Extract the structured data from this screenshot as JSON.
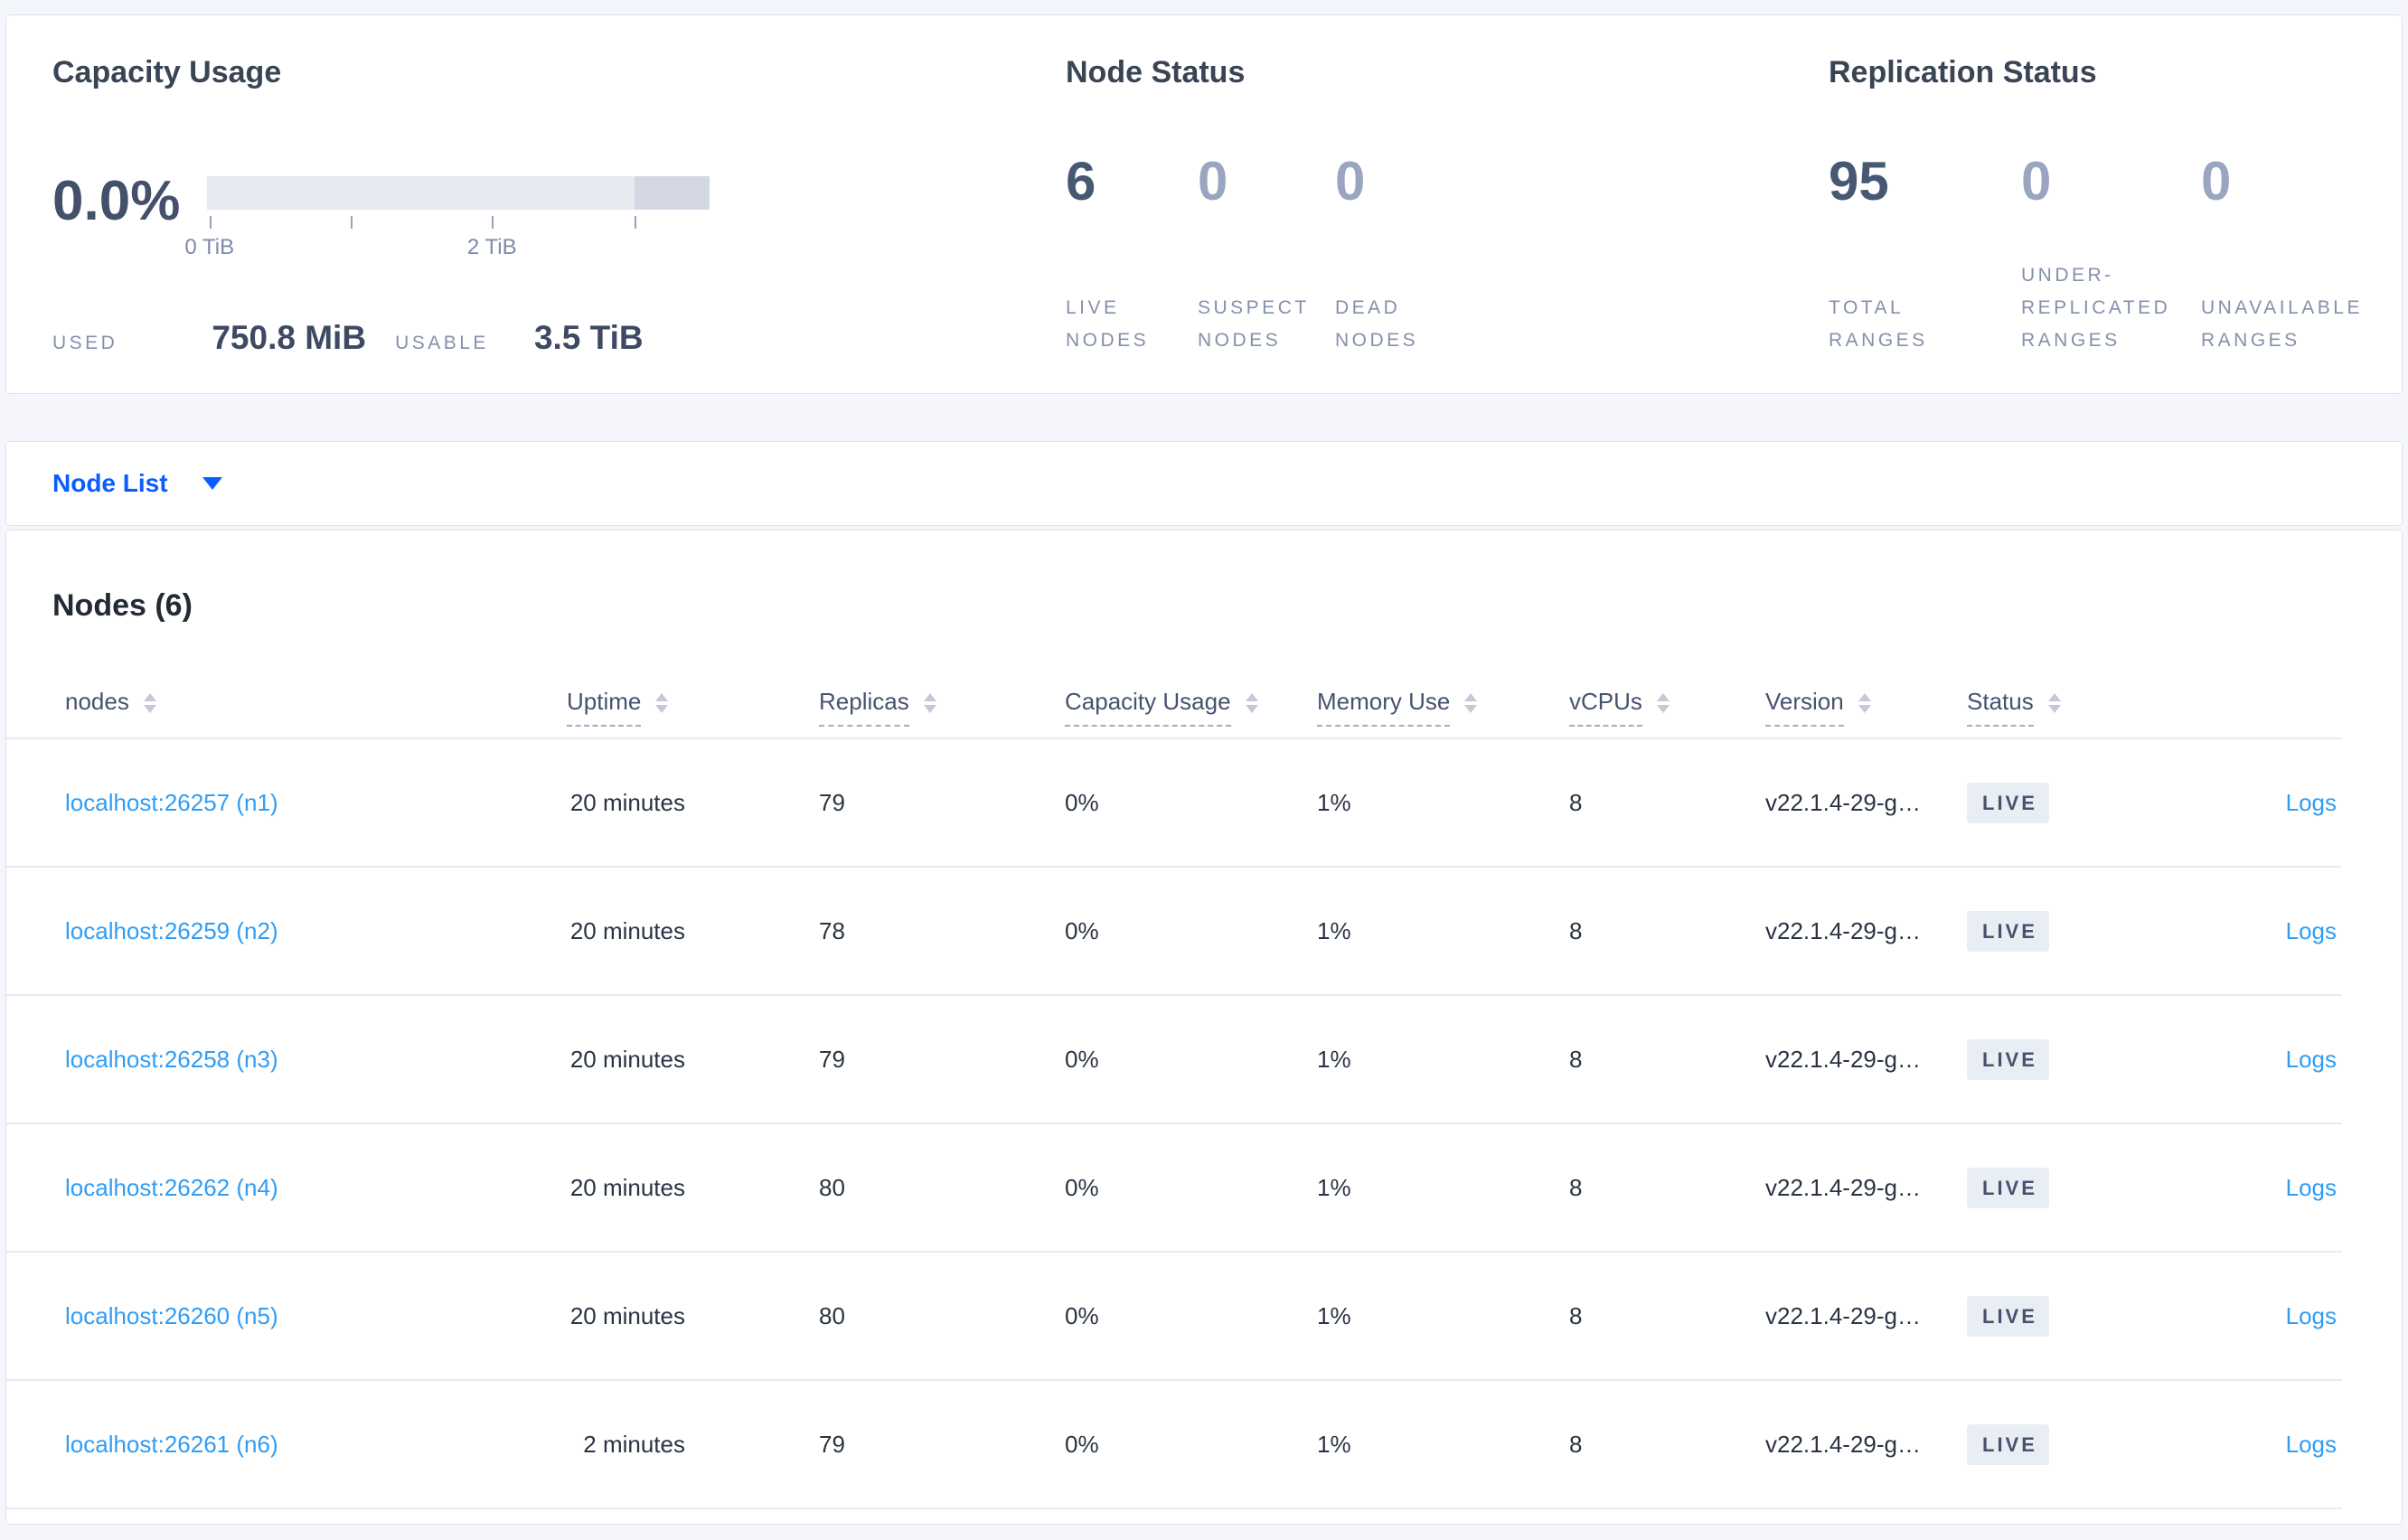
{
  "capacity": {
    "title": "Capacity Usage",
    "percent_used": "0.0%",
    "axis_tick_labels": [
      "0 TiB",
      "2 TiB"
    ],
    "used_label": "USED",
    "used_value": "750.8 MiB",
    "usable_label": "USABLE",
    "usable_value": "3.5 TiB"
  },
  "node_status": {
    "title": "Node Status",
    "stats": [
      {
        "value": "6",
        "label": "LIVE\nNODES"
      },
      {
        "value": "0",
        "label": "SUSPECT\nNODES"
      },
      {
        "value": "0",
        "label": "DEAD\nNODES"
      }
    ]
  },
  "replication_status": {
    "title": "Replication Status",
    "stats": [
      {
        "value": "95",
        "label": "TOTAL\nRANGES"
      },
      {
        "value": "0",
        "label": "UNDER-\nREPLICATED\nRANGES"
      },
      {
        "value": "0",
        "label": "UNAVAILABLE\nRANGES"
      }
    ]
  },
  "node_list": {
    "label": "Node List"
  },
  "nodes_table": {
    "heading": "Nodes (6)",
    "columns": [
      "nodes",
      "Uptime",
      "Replicas",
      "Capacity Usage",
      "Memory Use",
      "vCPUs",
      "Version",
      "Status"
    ],
    "rows": [
      {
        "address": "localhost:26257 (n1)",
        "uptime": "20 minutes",
        "replicas": "79",
        "capacity_usage": "0%",
        "memory_use": "1%",
        "vcpus": "8",
        "version": "v22.1.4-29-g…",
        "status": "LIVE",
        "logs": "Logs"
      },
      {
        "address": "localhost:26259 (n2)",
        "uptime": "20 minutes",
        "replicas": "78",
        "capacity_usage": "0%",
        "memory_use": "1%",
        "vcpus": "8",
        "version": "v22.1.4-29-g…",
        "status": "LIVE",
        "logs": "Logs"
      },
      {
        "address": "localhost:26258 (n3)",
        "uptime": "20 minutes",
        "replicas": "79",
        "capacity_usage": "0%",
        "memory_use": "1%",
        "vcpus": "8",
        "version": "v22.1.4-29-g…",
        "status": "LIVE",
        "logs": "Logs"
      },
      {
        "address": "localhost:26262 (n4)",
        "uptime": "20 minutes",
        "replicas": "80",
        "capacity_usage": "0%",
        "memory_use": "1%",
        "vcpus": "8",
        "version": "v22.1.4-29-g…",
        "status": "LIVE",
        "logs": "Logs"
      },
      {
        "address": "localhost:26260 (n5)",
        "uptime": "20 minutes",
        "replicas": "80",
        "capacity_usage": "0%",
        "memory_use": "1%",
        "vcpus": "8",
        "version": "v22.1.4-29-g…",
        "status": "LIVE",
        "logs": "Logs"
      },
      {
        "address": "localhost:26261 (n6)",
        "uptime": "2 minutes",
        "replicas": "79",
        "capacity_usage": "0%",
        "memory_use": "1%",
        "vcpus": "8",
        "version": "v22.1.4-29-g…",
        "status": "LIVE",
        "logs": "Logs"
      }
    ]
  },
  "colors": {
    "primary_blue": "#0b5cff",
    "link_blue": "#2f9df5",
    "dark_slate": "#475872",
    "muted_slate": "#9aa5bf",
    "label_gray": "#8490ab",
    "badge_bg": "#e9edf4",
    "bar_light": "#e8eaf2",
    "bar_dark": "#d3d7e3",
    "page_bg": "#f4f6fb"
  }
}
